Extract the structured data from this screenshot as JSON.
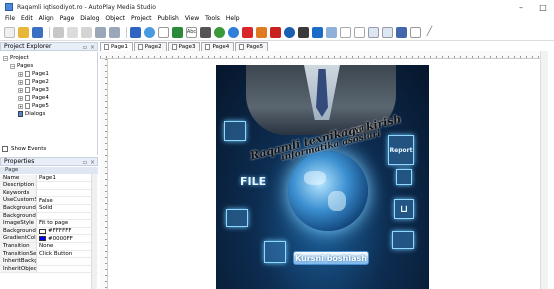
{
  "window": {
    "title": "Raqamli iqtisodiyot.ro - AutoPlay Media Studio",
    "minimize": "–",
    "maximize": "□"
  },
  "menu": [
    "File",
    "Edit",
    "Align",
    "Page",
    "Dialog",
    "Object",
    "Project",
    "Publish",
    "View",
    "Tools",
    "Help"
  ],
  "explorer": {
    "title": "Project Explorer",
    "items": {
      "project": "Project",
      "pages": "Pages",
      "page1": "Page1",
      "page2": "Page2",
      "page3": "Page3",
      "page4": "Page4",
      "page5": "Page5",
      "dialogs": "Dialogs"
    },
    "show_events": "Show Events"
  },
  "properties": {
    "title": "Properties",
    "group": "Page",
    "rows": [
      {
        "k": "Name",
        "v": "Page1"
      },
      {
        "k": "Description",
        "v": ""
      },
      {
        "k": "Keywords",
        "v": ""
      },
      {
        "k": "UseCustomSett",
        "v": "False"
      },
      {
        "k": "BackgroundStyl",
        "v": "Solid"
      },
      {
        "k": "BackgroundIma",
        "v": ""
      },
      {
        "k": "ImageStyle",
        "v": "Fit to page"
      },
      {
        "k": "BackgroundCol",
        "v": "#FFFFFF",
        "color": "#FFFFFF"
      },
      {
        "k": "GradientColor",
        "v": "#0000FF",
        "color": "#0000FF"
      },
      {
        "k": "Transition",
        "v": "None"
      },
      {
        "k": "TransitionSettin",
        "v": "Click Button"
      },
      {
        "k": "InheritBackgrou",
        "v": ""
      },
      {
        "k": "InheritObjects",
        "v": ""
      }
    ]
  },
  "tabs": [
    "Page1",
    "Page2",
    "Page3",
    "Page4",
    "Page5"
  ],
  "page": {
    "banner_line1": "Raqamli texnikaga kirish",
    "banner_line2": "va",
    "banner_line3": "informatika asoslari",
    "file_label": "FILE",
    "report_label": "Report",
    "button_label": "Kursni boshlash"
  }
}
